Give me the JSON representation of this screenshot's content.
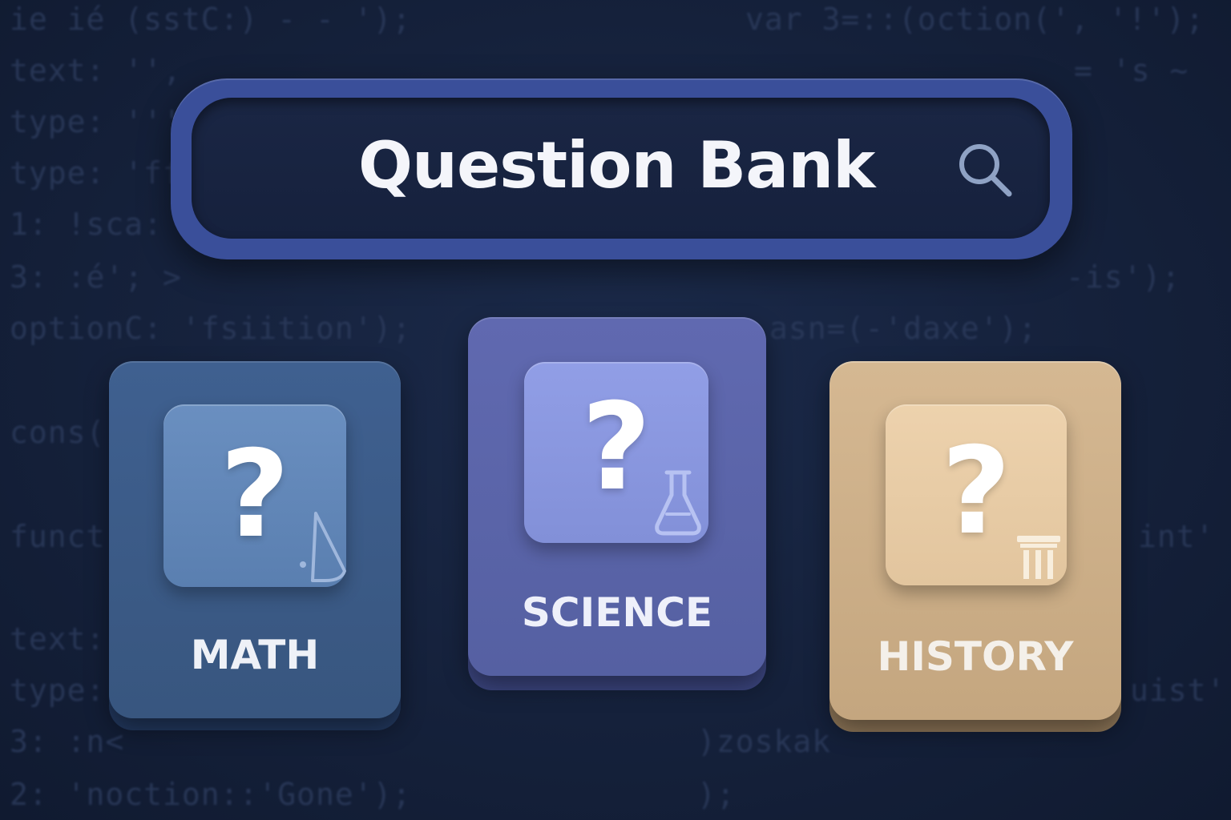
{
  "background_code": [
    "ie ié (sstC:) - - ');",
    "var 3=::(oction(', '!');",
    "text: '',",
    "= 's ~",
    "type: '''",
    "type: 'ff",
    "1: !sca:",
    "3: :é'; >",
    "-is');",
    "optionC: 'fsiition');",
    "asn=(-'daxe');",
    "cons(",
    "funct",
    "int'",
    "text:",
    "type:",
    "uist'",
    "3: :n<",
    ")zoskak",
    "2: 'noction::'Gone');",
    ");"
  ],
  "search": {
    "title": "Question Bank",
    "icon": "search-icon"
  },
  "categories": [
    {
      "label": "MATH",
      "symbol": "?",
      "icon": "cone-icon",
      "color": "#3b5a8a",
      "tile_color": "#5f85b8",
      "label_color": "#eef1f7"
    },
    {
      "label": "SCIENCE",
      "symbol": "?",
      "icon": "flask-icon",
      "color": "#5762a6",
      "tile_color": "#8794dc",
      "label_color": "#eef0fa"
    },
    {
      "label": "HISTORY",
      "symbol": "?",
      "icon": "column-icon",
      "color": "#c9ac86",
      "tile_color": "#e6c9a2",
      "label_color": "#f4f0ea"
    }
  ],
  "colors": {
    "background": "#15213b",
    "search_border": "#3a4f9a",
    "search_fill": "#16213d",
    "title_text": "#f4f5fa"
  }
}
